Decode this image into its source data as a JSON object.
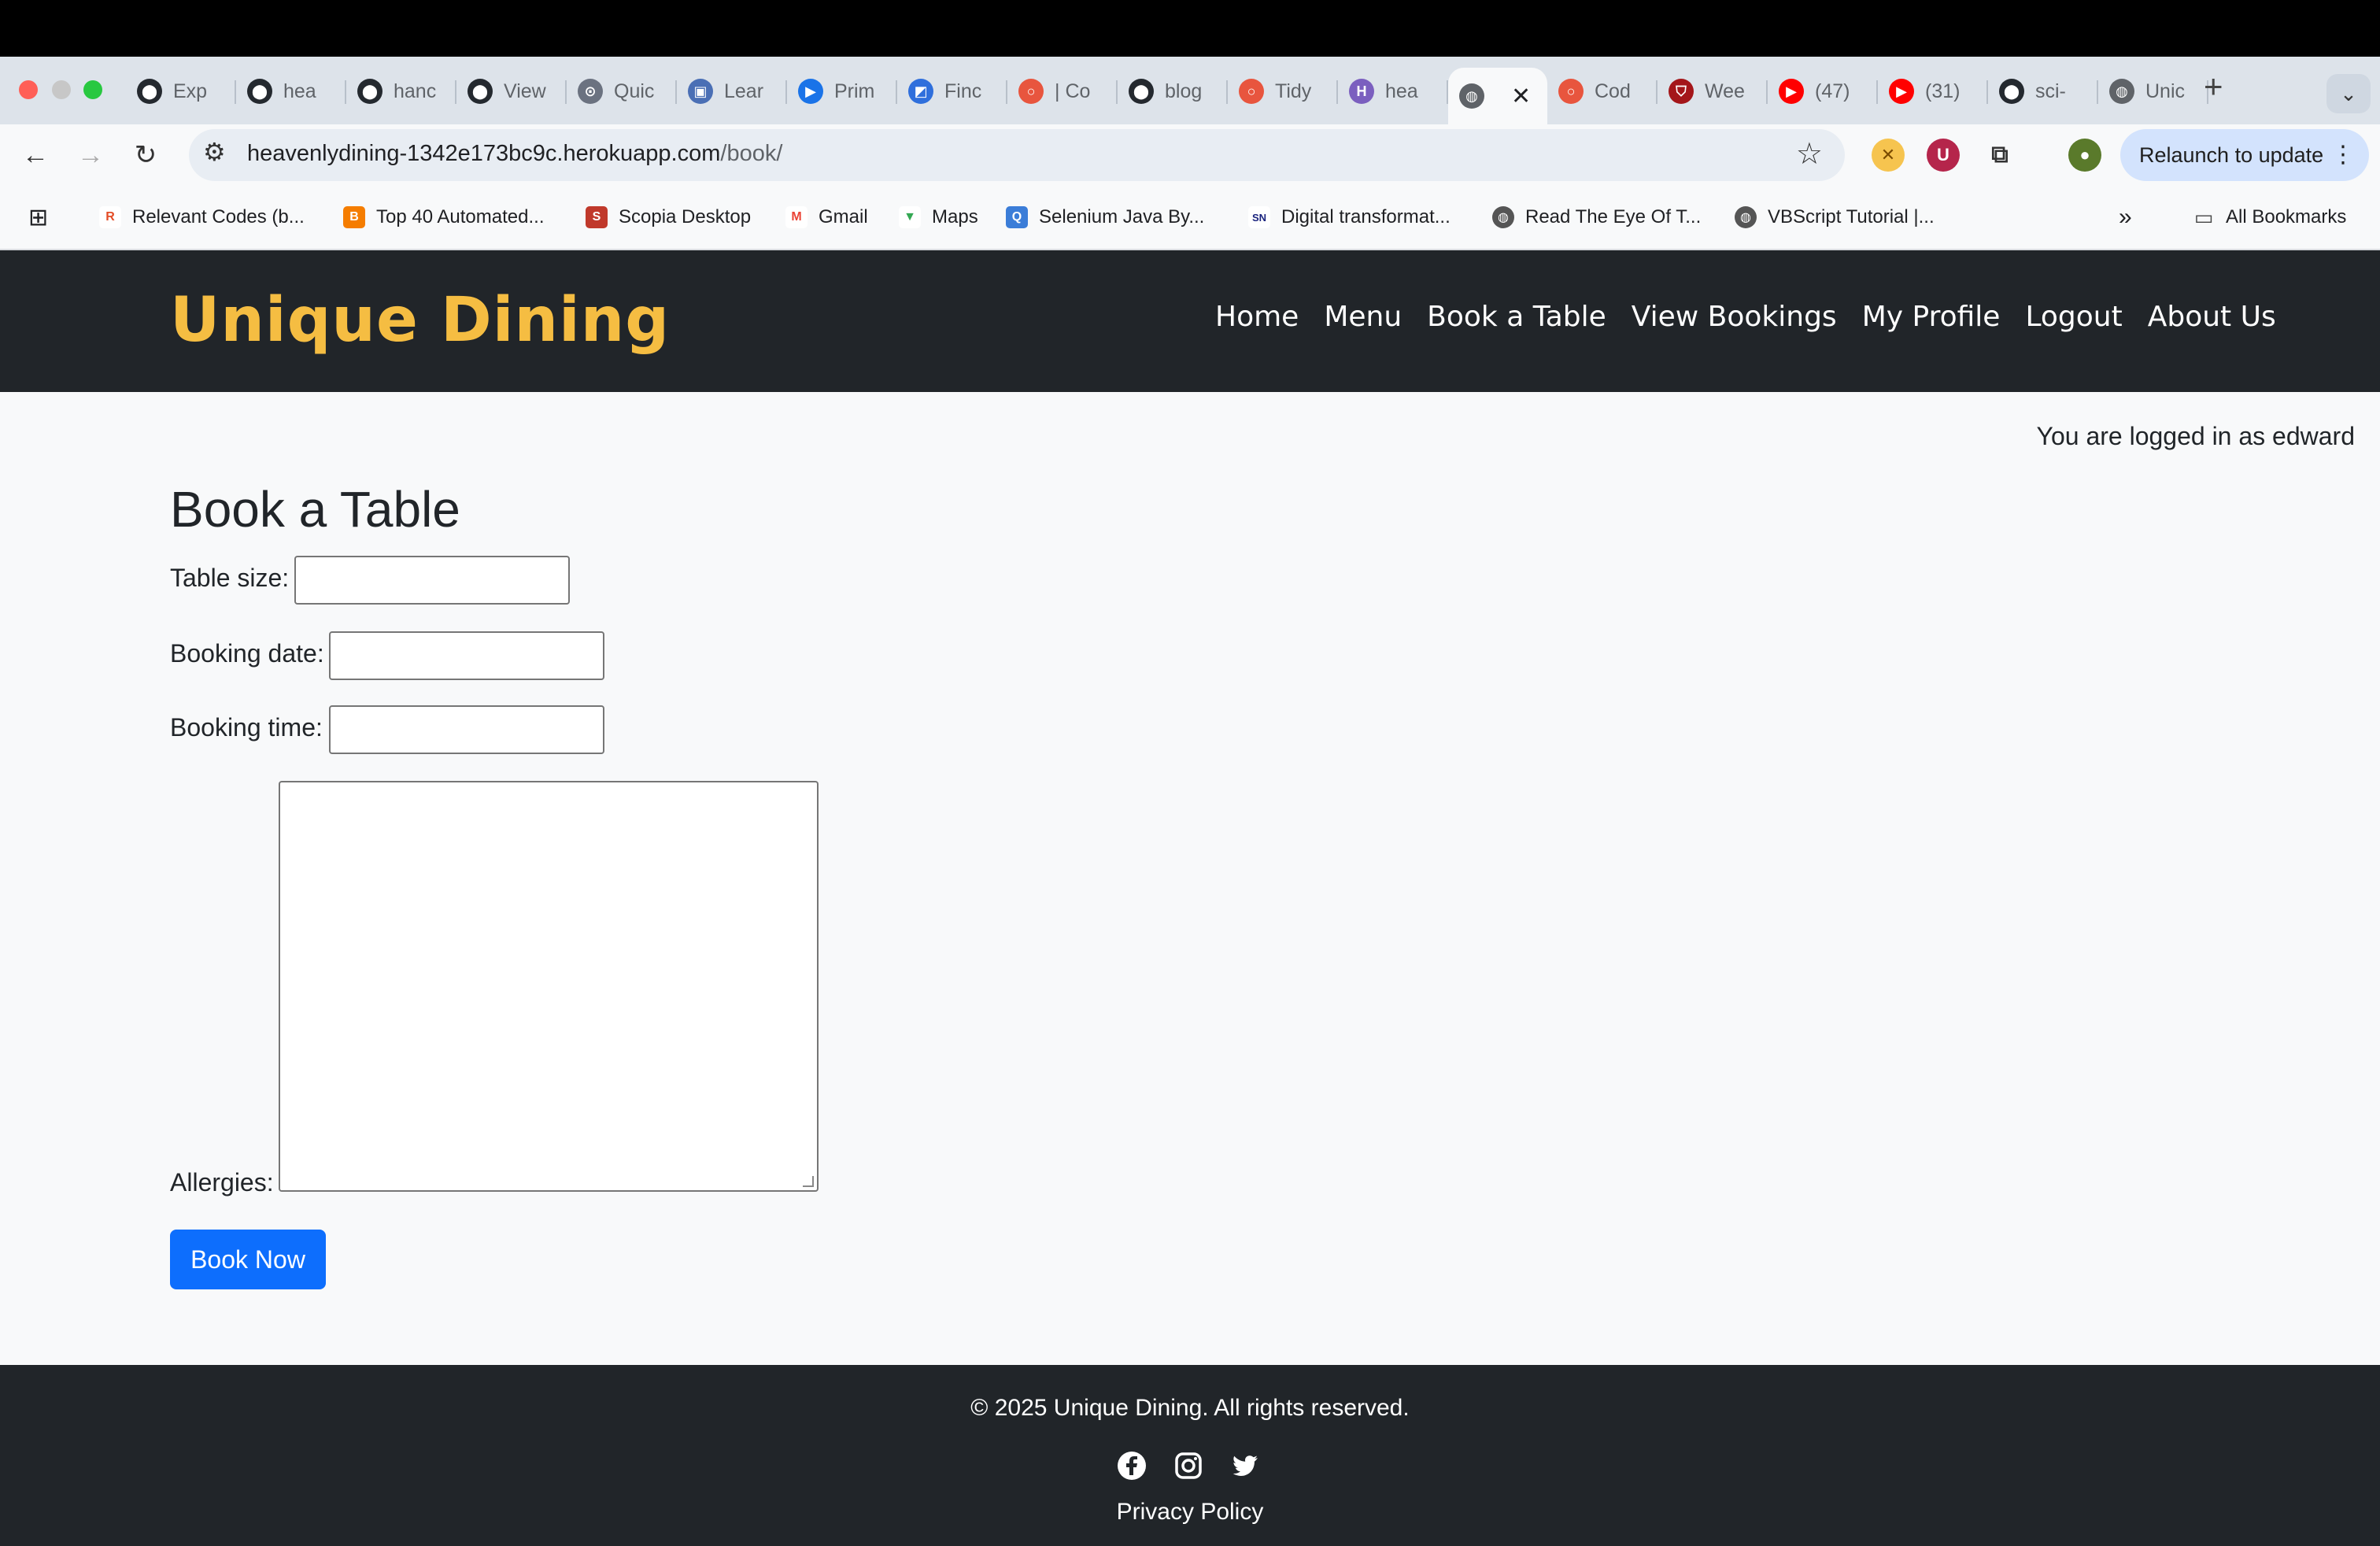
{
  "browser": {
    "tabs": [
      {
        "title": "Exp",
        "icon": "github-icon"
      },
      {
        "title": "hea",
        "icon": "github-icon"
      },
      {
        "title": "hanc",
        "icon": "github-icon"
      },
      {
        "title": "View",
        "icon": "github-icon"
      },
      {
        "title": "Quic",
        "icon": "quick-icon"
      },
      {
        "title": "Lear",
        "icon": "learn-icon"
      },
      {
        "title": "Prim",
        "icon": "play-icon"
      },
      {
        "title": "Finc",
        "icon": "find-icon"
      },
      {
        "title": "| Co",
        "icon": "ring-icon"
      },
      {
        "title": "blog",
        "icon": "github-icon"
      },
      {
        "title": "Tidy",
        "icon": "ring-icon"
      },
      {
        "title": "hea",
        "icon": "heroku-icon"
      },
      {
        "title": "",
        "icon": "globe-icon",
        "active": true
      },
      {
        "title": "Cod",
        "icon": "ring-icon"
      },
      {
        "title": "Wee",
        "icon": "shield-icon"
      },
      {
        "title": "(47)",
        "icon": "youtube-icon"
      },
      {
        "title": "(31)",
        "icon": "youtube-icon"
      },
      {
        "title": "sci-",
        "icon": "github-icon"
      },
      {
        "title": "Unic",
        "icon": "globe-icon"
      }
    ],
    "url_host": "heavenlydining-1342e173bc9c.herokuapp.com",
    "url_path": "/book/",
    "relaunch_label": "Relaunch to update",
    "bookmarks": [
      "Relevant Codes (b...",
      "Top 40 Automated...",
      "Scopia Desktop",
      "Gmail",
      "Maps",
      "Selenium Java By...",
      "Digital transformat...",
      "Read The Eye Of T...",
      "VBScript Tutorial |..."
    ],
    "all_bookmarks_label": "All Bookmarks",
    "colors": {
      "chrome": "#dde3ea",
      "relaunch": "#d3e3fd"
    }
  },
  "site": {
    "brand": "Unique Dining",
    "nav": [
      "Home",
      "Menu",
      "Book a Table",
      "View Bookings",
      "My Profile",
      "Logout",
      "About Us"
    ],
    "logged_in": "You are logged in as edward",
    "colors": {
      "brand": "#f5bd42",
      "navbar": "#212529",
      "primary": "#0d6efd"
    }
  },
  "form": {
    "title": "Book a Table",
    "table_size_label": "Table size:",
    "booking_date_label": "Booking date:",
    "booking_time_label": "Booking time:",
    "allergies_label": "Allergies:",
    "submit_label": "Book Now"
  },
  "footer": {
    "copyright": "© 2025 Unique Dining. All rights reserved.",
    "socials": [
      "facebook-icon",
      "instagram-icon",
      "twitter-icon"
    ],
    "privacy": "Privacy Policy"
  }
}
